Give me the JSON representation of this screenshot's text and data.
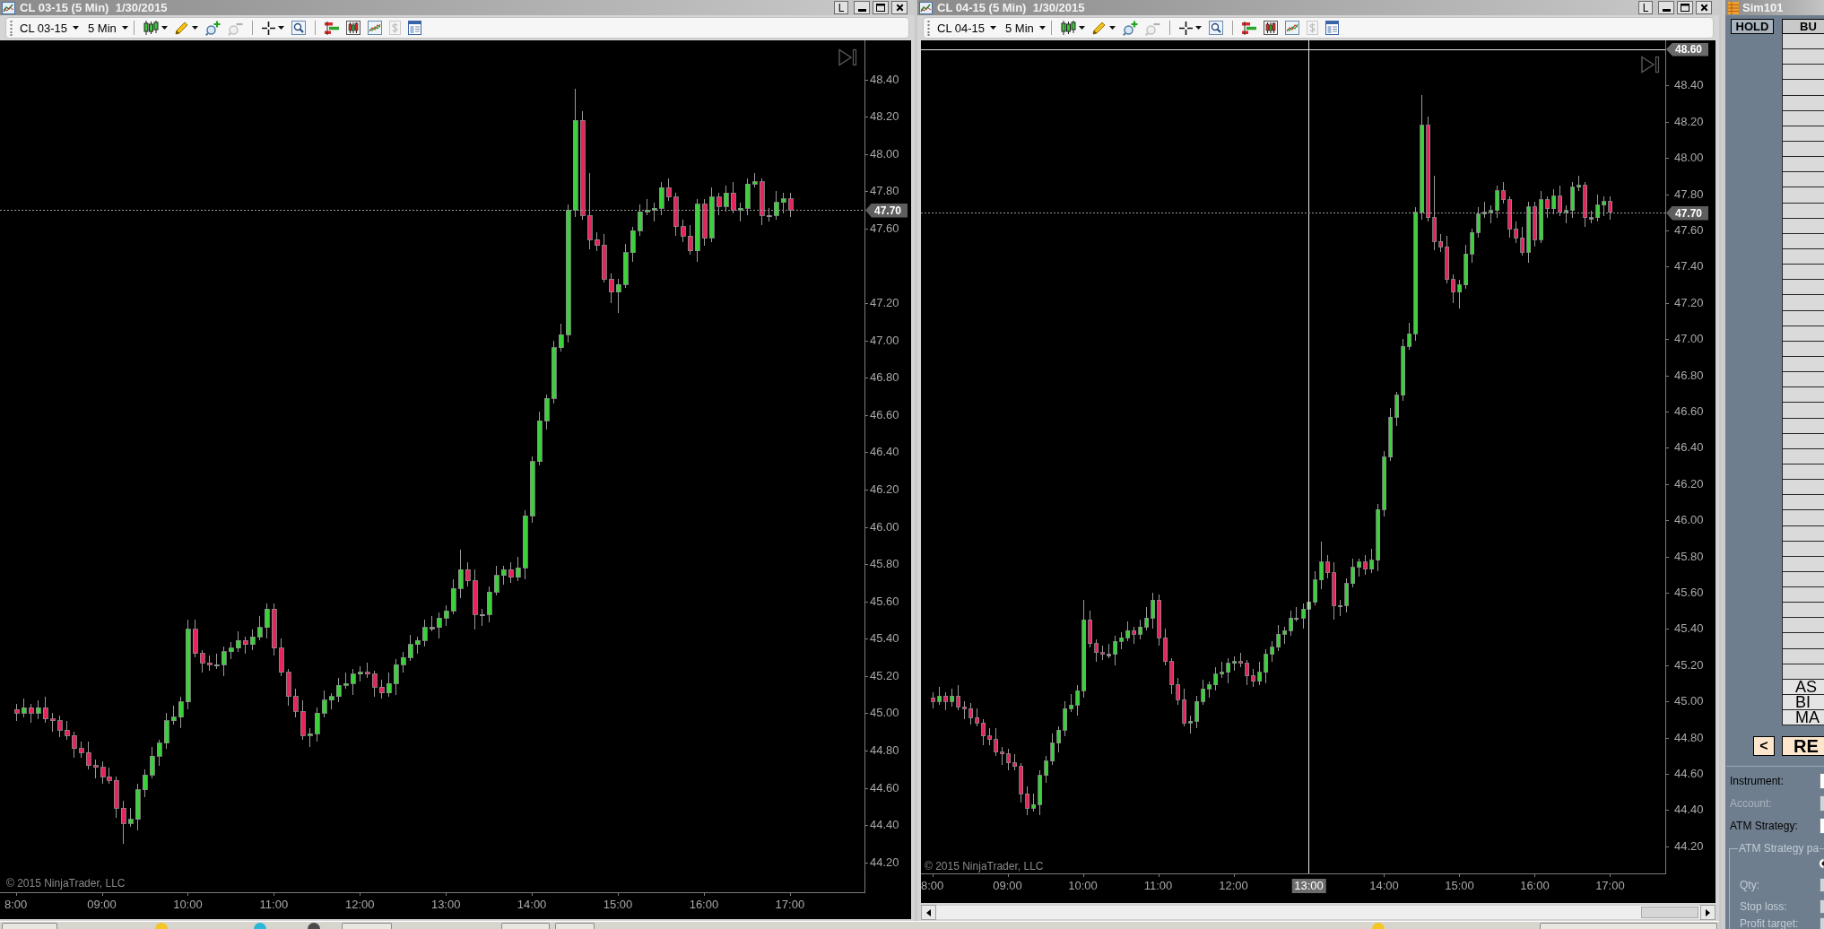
{
  "charts": [
    {
      "title": "CL 03-15 (5 Min)  1/30/2015",
      "title_button": "L",
      "toolbar": {
        "instrument": "CL 03-15",
        "interval": "5 Min",
        "tool_groups": [
          [
            {
              "kind": "chart-style",
              "disabled": false
            },
            {
              "kind": "drawing",
              "disabled": false
            },
            {
              "kind": "zoom-in",
              "disabled": false
            },
            {
              "kind": "zoom-out",
              "disabled": true
            }
          ],
          [
            {
              "kind": "crosshair",
              "disabled": false
            },
            {
              "kind": "find",
              "disabled": false
            }
          ],
          [
            {
              "kind": "order-bars",
              "disabled": false
            },
            {
              "kind": "candles",
              "disabled": false
            },
            {
              "kind": "indicators",
              "disabled": false
            },
            {
              "kind": "dollar",
              "disabled": true
            },
            {
              "kind": "properties",
              "disabled": false
            }
          ]
        ]
      },
      "chart_data": {
        "type": "candlestick",
        "xlim": [
          7.8167,
          17.8667
        ],
        "ylim": [
          44.04,
          48.61
        ],
        "x": [
          8,
          8.0833,
          8.1667,
          8.25,
          8.3333,
          8.4167,
          8.5,
          8.5833,
          8.6667,
          8.75,
          8.8333,
          8.9167,
          9,
          9.0833,
          9.1667,
          9.25,
          9.3333,
          9.4167,
          9.5,
          9.5833,
          9.6667,
          9.75,
          9.8333,
          9.9167,
          10,
          10.0833,
          10.1667,
          10.25,
          10.3333,
          10.4167,
          10.5,
          10.5833,
          10.6667,
          10.75,
          10.8333,
          10.9167,
          11,
          11.0833,
          11.1667,
          11.25,
          11.3333,
          11.4167,
          11.5,
          11.5833,
          11.6667,
          11.75,
          11.8333,
          11.9167,
          12,
          12.0833,
          12.1667,
          12.25,
          12.3333,
          12.4167,
          12.5,
          12.5833,
          12.6667,
          12.75,
          12.8333,
          12.9167,
          13,
          13.0833,
          13.1667,
          13.25,
          13.3333,
          13.4167,
          13.5,
          13.5833,
          13.6667,
          13.75,
          13.8333,
          13.9167,
          14,
          14.0833,
          14.1667,
          14.25,
          14.3333,
          14.4167,
          14.5,
          14.5833,
          14.6667,
          14.75,
          14.8333,
          14.9167,
          15,
          15.0833,
          15.1667,
          15.25,
          15.3333,
          15.4167,
          15.5,
          15.5833,
          15.6667,
          15.75,
          15.8333,
          15.9167,
          16,
          16.0833,
          16.1667,
          16.25,
          16.3333,
          16.4167,
          16.5,
          16.5833,
          16.6667,
          16.75,
          16.8333,
          16.9167,
          17
        ],
        "ohlc": [
          [
            45.02,
            45.05,
            44.96,
            45.0
          ],
          [
            45.0,
            45.08,
            44.98,
            45.03
          ],
          [
            45.03,
            45.05,
            44.95,
            45.0
          ],
          [
            45.0,
            45.07,
            44.97,
            45.03
          ],
          [
            45.03,
            45.09,
            44.95,
            44.97
          ],
          [
            44.97,
            45.0,
            44.9,
            44.96
          ],
          [
            44.96,
            44.99,
            44.87,
            44.91
          ],
          [
            44.91,
            44.96,
            44.86,
            44.88
          ],
          [
            44.88,
            44.9,
            44.76,
            44.81
          ],
          [
            44.81,
            44.85,
            44.76,
            44.79
          ],
          [
            44.79,
            44.85,
            44.7,
            44.72
          ],
          [
            44.72,
            44.75,
            44.65,
            44.71
          ],
          [
            44.71,
            44.74,
            44.62,
            44.66
          ],
          [
            44.66,
            44.71,
            44.62,
            44.64
          ],
          [
            44.64,
            44.66,
            44.44,
            44.49
          ],
          [
            44.49,
            44.53,
            44.3,
            44.41
          ],
          [
            44.41,
            44.49,
            44.39,
            44.43
          ],
          [
            44.43,
            44.62,
            44.37,
            44.59
          ],
          [
            44.59,
            44.7,
            44.55,
            44.67
          ],
          [
            44.67,
            44.82,
            44.65,
            44.77
          ],
          [
            44.77,
            44.86,
            44.72,
            44.84
          ],
          [
            44.84,
            45.0,
            44.81,
            44.96
          ],
          [
            44.96,
            45.04,
            44.94,
            44.98
          ],
          [
            44.98,
            45.09,
            44.92,
            45.06
          ],
          [
            45.06,
            45.5,
            45.02,
            45.45
          ],
          [
            45.45,
            45.5,
            45.3,
            45.32
          ],
          [
            45.32,
            45.34,
            45.22,
            45.27
          ],
          [
            45.27,
            45.31,
            45.23,
            45.26
          ],
          [
            45.26,
            45.32,
            45.24,
            45.26
          ],
          [
            45.26,
            45.36,
            45.2,
            45.33
          ],
          [
            45.33,
            45.38,
            45.29,
            45.35
          ],
          [
            45.35,
            45.44,
            45.33,
            45.39
          ],
          [
            45.39,
            45.41,
            45.32,
            45.37
          ],
          [
            45.37,
            45.45,
            45.34,
            45.41
          ],
          [
            45.41,
            45.52,
            45.39,
            45.46
          ],
          [
            45.46,
            45.59,
            45.4,
            45.56
          ],
          [
            45.56,
            45.59,
            45.31,
            45.35
          ],
          [
            45.35,
            45.4,
            45.2,
            45.22
          ],
          [
            45.22,
            45.24,
            45.04,
            45.09
          ],
          [
            45.09,
            45.13,
            44.98,
            45.01
          ],
          [
            45.01,
            45.07,
            44.86,
            44.88
          ],
          [
            44.88,
            44.92,
            44.82,
            44.89
          ],
          [
            44.89,
            45.03,
            44.85,
            45.0
          ],
          [
            45.0,
            45.12,
            44.98,
            45.07
          ],
          [
            45.07,
            45.11,
            45.02,
            45.09
          ],
          [
            45.09,
            45.19,
            45.06,
            45.15
          ],
          [
            45.15,
            45.22,
            45.13,
            45.16
          ],
          [
            45.16,
            45.24,
            45.1,
            45.21
          ],
          [
            45.21,
            45.25,
            45.17,
            45.22
          ],
          [
            45.22,
            45.27,
            45.19,
            45.21
          ],
          [
            45.21,
            45.23,
            45.09,
            45.14
          ],
          [
            45.14,
            45.18,
            45.08,
            45.11
          ],
          [
            45.11,
            45.22,
            45.09,
            45.16
          ],
          [
            45.16,
            45.29,
            45.1,
            45.26
          ],
          [
            45.26,
            45.33,
            45.22,
            45.3
          ],
          [
            45.3,
            45.42,
            45.28,
            45.37
          ],
          [
            45.37,
            45.41,
            45.32,
            45.39
          ],
          [
            45.39,
            45.5,
            45.36,
            45.46
          ],
          [
            45.46,
            45.52,
            45.44,
            45.46
          ],
          [
            45.46,
            45.54,
            45.4,
            45.51
          ],
          [
            45.51,
            45.58,
            45.47,
            45.55
          ],
          [
            45.55,
            45.72,
            45.53,
            45.67
          ],
          [
            45.67,
            45.88,
            45.62,
            45.77
          ],
          [
            45.77,
            45.81,
            45.68,
            45.71
          ],
          [
            45.71,
            45.77,
            45.45,
            45.53
          ],
          [
            45.53,
            45.56,
            45.47,
            45.53
          ],
          [
            45.53,
            45.68,
            45.49,
            45.65
          ],
          [
            45.65,
            45.79,
            45.63,
            45.74
          ],
          [
            45.74,
            45.79,
            45.69,
            45.77
          ],
          [
            45.77,
            45.81,
            45.7,
            45.73
          ],
          [
            45.73,
            45.84,
            45.71,
            45.78
          ],
          [
            45.78,
            46.09,
            45.72,
            46.06
          ],
          [
            46.06,
            46.38,
            46.02,
            46.35
          ],
          [
            46.35,
            46.62,
            46.33,
            46.57
          ],
          [
            46.57,
            46.71,
            46.52,
            46.69
          ],
          [
            46.69,
            47.0,
            46.66,
            46.96
          ],
          [
            46.96,
            47.09,
            46.94,
            47.03
          ],
          [
            47.03,
            47.73,
            46.99,
            47.7
          ],
          [
            47.7,
            48.35,
            47.66,
            48.18
          ],
          [
            48.18,
            48.23,
            47.65,
            47.67
          ],
          [
            47.67,
            47.9,
            47.49,
            47.54
          ],
          [
            47.54,
            47.58,
            47.48,
            47.51
          ],
          [
            47.51,
            47.57,
            47.31,
            47.33
          ],
          [
            47.33,
            47.36,
            47.2,
            47.26
          ],
          [
            47.26,
            47.33,
            47.15,
            47.3
          ],
          [
            47.3,
            47.52,
            47.28,
            47.47
          ],
          [
            47.47,
            47.61,
            47.42,
            47.59
          ],
          [
            47.59,
            47.73,
            47.56,
            47.69
          ],
          [
            47.69,
            47.76,
            47.67,
            47.7
          ],
          [
            47.7,
            47.74,
            47.64,
            47.71
          ],
          [
            47.71,
            47.85,
            47.67,
            47.82
          ],
          [
            47.82,
            47.87,
            47.75,
            47.77
          ],
          [
            47.77,
            47.79,
            47.56,
            47.61
          ],
          [
            47.61,
            47.65,
            47.53,
            47.56
          ],
          [
            47.56,
            47.62,
            47.46,
            47.48
          ],
          [
            47.48,
            47.76,
            47.42,
            47.73
          ],
          [
            47.73,
            47.76,
            47.51,
            47.55
          ],
          [
            47.55,
            47.82,
            47.53,
            47.77
          ],
          [
            47.77,
            47.79,
            47.67,
            47.72
          ],
          [
            47.72,
            47.83,
            47.69,
            47.79
          ],
          [
            47.79,
            47.85,
            47.68,
            47.7
          ],
          [
            47.7,
            47.74,
            47.64,
            47.71
          ],
          [
            47.71,
            47.87,
            47.67,
            47.84
          ],
          [
            47.84,
            47.9,
            47.82,
            47.85
          ],
          [
            47.85,
            47.87,
            47.62,
            47.67
          ],
          [
            47.67,
            47.71,
            47.64,
            47.67
          ],
          [
            47.67,
            47.8,
            47.65,
            47.74
          ],
          [
            47.74,
            47.79,
            47.68,
            47.76
          ],
          [
            47.76,
            47.79,
            47.66,
            47.7
          ]
        ],
        "yticks": [
          {
            "value": 48.4,
            "label": "48.40"
          },
          {
            "value": 48.2,
            "label": "48.20"
          },
          {
            "value": 48.0,
            "label": "48.00"
          },
          {
            "value": 47.8,
            "label": "47.80"
          },
          {
            "value": 47.6,
            "label": "47.60"
          },
          {
            "value": 47.2,
            "label": "47.20"
          },
          {
            "value": 47.0,
            "label": "47.00"
          },
          {
            "value": 46.8,
            "label": "46.80"
          },
          {
            "value": 46.6,
            "label": "46.60"
          },
          {
            "value": 46.4,
            "label": "46.40"
          },
          {
            "value": 46.2,
            "label": "46.20"
          },
          {
            "value": 46.0,
            "label": "46.00"
          },
          {
            "value": 45.8,
            "label": "45.80"
          },
          {
            "value": 45.6,
            "label": "45.60"
          },
          {
            "value": 45.4,
            "label": "45.40"
          },
          {
            "value": 45.2,
            "label": "45.20"
          },
          {
            "value": 45.0,
            "label": "45.00"
          },
          {
            "value": 44.8,
            "label": "44.80"
          },
          {
            "value": 44.6,
            "label": "44.60"
          },
          {
            "value": 44.4,
            "label": "44.40"
          },
          {
            "value": 44.2,
            "label": "44.20"
          }
        ],
        "xticks": [
          {
            "value": 8,
            "label": "8:00"
          },
          {
            "value": 9,
            "label": "09:00"
          },
          {
            "value": 10,
            "label": "10:00"
          },
          {
            "value": 11,
            "label": "11:00"
          },
          {
            "value": 12,
            "label": "12:00"
          },
          {
            "value": 13,
            "label": "13:00"
          },
          {
            "value": 14,
            "label": "14:00"
          },
          {
            "value": 15,
            "label": "15:00"
          },
          {
            "value": 16,
            "label": "16:00"
          },
          {
            "value": 17,
            "label": "17:00"
          }
        ],
        "ref_lines": [
          {
            "axis": "y",
            "value": 47.7,
            "label": "47.70",
            "color": "#9a9a9a"
          }
        ]
      },
      "copyright": "© 2015 NinjaTrader, LLC"
    },
    {
      "title": "CL 04-15 (5 Min)  1/30/2015",
      "title_button": "L",
      "toolbar": {
        "instrument": "CL 04-15",
        "interval": "5 Min",
        "tool_groups": [
          [
            {
              "kind": "chart-style",
              "disabled": false
            },
            {
              "kind": "drawing",
              "disabled": false
            },
            {
              "kind": "zoom-in",
              "disabled": false
            },
            {
              "kind": "zoom-out",
              "disabled": true
            }
          ],
          [
            {
              "kind": "crosshair",
              "disabled": false
            },
            {
              "kind": "find",
              "disabled": false
            }
          ],
          [
            {
              "kind": "order-bars",
              "disabled": false
            },
            {
              "kind": "candles",
              "disabled": false
            },
            {
              "kind": "indicators",
              "disabled": false
            },
            {
              "kind": "dollar",
              "disabled": true
            },
            {
              "kind": "properties",
              "disabled": false
            }
          ]
        ]
      },
      "chart_data": {
        "type": "candlestick",
        "xlim": [
          7.85,
          17.7333
        ],
        "ylim": [
          44.05,
          48.65
        ],
        "x": [
          8,
          8.0833,
          8.1667,
          8.25,
          8.3333,
          8.4167,
          8.5,
          8.5833,
          8.6667,
          8.75,
          8.8333,
          8.9167,
          9,
          9.0833,
          9.1667,
          9.25,
          9.3333,
          9.4167,
          9.5,
          9.5833,
          9.6667,
          9.75,
          9.8333,
          9.9167,
          10,
          10.0833,
          10.1667,
          10.25,
          10.3333,
          10.4167,
          10.5,
          10.5833,
          10.6667,
          10.75,
          10.8333,
          10.9167,
          11,
          11.0833,
          11.1667,
          11.25,
          11.3333,
          11.4167,
          11.5,
          11.5833,
          11.6667,
          11.75,
          11.8333,
          11.9167,
          12,
          12.0833,
          12.1667,
          12.25,
          12.3333,
          12.4167,
          12.5,
          12.5833,
          12.6667,
          12.75,
          12.8333,
          12.9167,
          13,
          13.0833,
          13.1667,
          13.25,
          13.3333,
          13.4167,
          13.5,
          13.5833,
          13.6667,
          13.75,
          13.8333,
          13.9167,
          14,
          14.0833,
          14.1667,
          14.25,
          14.3333,
          14.4167,
          14.5,
          14.5833,
          14.6667,
          14.75,
          14.8333,
          14.9167,
          15,
          15.0833,
          15.1667,
          15.25,
          15.3333,
          15.4167,
          15.5,
          15.5833,
          15.6667,
          15.75,
          15.8333,
          15.9167,
          16,
          16.0833,
          16.1667,
          16.25,
          16.3333,
          16.4167,
          16.5,
          16.5833,
          16.6667,
          16.75,
          16.8333,
          16.9167,
          17
        ],
        "ohlc": [
          [
            45.02,
            45.05,
            44.96,
            45.0
          ],
          [
            45.0,
            45.08,
            44.98,
            45.03
          ],
          [
            45.03,
            45.05,
            44.95,
            45.0
          ],
          [
            45.0,
            45.07,
            44.97,
            45.03
          ],
          [
            45.03,
            45.09,
            44.95,
            44.97
          ],
          [
            44.97,
            45.0,
            44.9,
            44.96
          ],
          [
            44.96,
            44.99,
            44.87,
            44.91
          ],
          [
            44.91,
            44.96,
            44.86,
            44.88
          ],
          [
            44.88,
            44.9,
            44.76,
            44.81
          ],
          [
            44.81,
            44.85,
            44.76,
            44.79
          ],
          [
            44.79,
            44.85,
            44.7,
            44.72
          ],
          [
            44.72,
            44.75,
            44.65,
            44.71
          ],
          [
            44.71,
            44.74,
            44.62,
            44.66
          ],
          [
            44.66,
            44.71,
            44.62,
            44.64
          ],
          [
            44.64,
            44.66,
            44.44,
            44.49
          ],
          [
            44.49,
            44.53,
            44.37,
            44.41
          ],
          [
            44.41,
            44.49,
            44.39,
            44.43
          ],
          [
            44.43,
            44.62,
            44.37,
            44.59
          ],
          [
            44.59,
            44.7,
            44.55,
            44.67
          ],
          [
            44.67,
            44.82,
            44.65,
            44.77
          ],
          [
            44.77,
            44.86,
            44.72,
            44.84
          ],
          [
            44.84,
            45.0,
            44.81,
            44.96
          ],
          [
            44.96,
            45.04,
            44.94,
            44.98
          ],
          [
            44.98,
            45.09,
            44.92,
            45.06
          ],
          [
            45.06,
            45.56,
            45.02,
            45.45
          ],
          [
            45.45,
            45.5,
            45.3,
            45.32
          ],
          [
            45.32,
            45.34,
            45.22,
            45.27
          ],
          [
            45.27,
            45.31,
            45.23,
            45.26
          ],
          [
            45.26,
            45.32,
            45.24,
            45.26
          ],
          [
            45.26,
            45.36,
            45.2,
            45.33
          ],
          [
            45.33,
            45.38,
            45.29,
            45.35
          ],
          [
            45.35,
            45.44,
            45.33,
            45.39
          ],
          [
            45.39,
            45.41,
            45.32,
            45.37
          ],
          [
            45.37,
            45.45,
            45.34,
            45.41
          ],
          [
            45.41,
            45.52,
            45.39,
            45.46
          ],
          [
            45.46,
            45.6,
            45.4,
            45.56
          ],
          [
            45.56,
            45.59,
            45.31,
            45.35
          ],
          [
            45.35,
            45.4,
            45.2,
            45.22
          ],
          [
            45.22,
            45.24,
            45.04,
            45.09
          ],
          [
            45.09,
            45.13,
            44.98,
            45.01
          ],
          [
            45.01,
            45.07,
            44.86,
            44.88
          ],
          [
            44.88,
            44.92,
            44.82,
            44.89
          ],
          [
            44.89,
            45.03,
            44.85,
            45.0
          ],
          [
            45.0,
            45.12,
            44.98,
            45.07
          ],
          [
            45.07,
            45.11,
            45.02,
            45.09
          ],
          [
            45.09,
            45.19,
            45.06,
            45.15
          ],
          [
            45.15,
            45.22,
            45.13,
            45.16
          ],
          [
            45.16,
            45.24,
            45.1,
            45.21
          ],
          [
            45.21,
            45.25,
            45.17,
            45.22
          ],
          [
            45.22,
            45.27,
            45.19,
            45.21
          ],
          [
            45.21,
            45.23,
            45.09,
            45.14
          ],
          [
            45.14,
            45.18,
            45.08,
            45.11
          ],
          [
            45.11,
            45.22,
            45.09,
            45.16
          ],
          [
            45.16,
            45.29,
            45.1,
            45.26
          ],
          [
            45.26,
            45.33,
            45.22,
            45.3
          ],
          [
            45.3,
            45.42,
            45.28,
            45.37
          ],
          [
            45.37,
            45.41,
            45.32,
            45.39
          ],
          [
            45.39,
            45.5,
            45.36,
            45.46
          ],
          [
            45.46,
            45.52,
            45.44,
            45.46
          ],
          [
            45.46,
            45.54,
            45.4,
            45.51
          ],
          [
            45.51,
            45.58,
            45.47,
            45.55
          ],
          [
            45.55,
            45.72,
            45.53,
            45.67
          ],
          [
            45.67,
            45.88,
            45.62,
            45.77
          ],
          [
            45.77,
            45.81,
            45.68,
            45.71
          ],
          [
            45.71,
            45.77,
            45.45,
            45.53
          ],
          [
            45.53,
            45.56,
            45.47,
            45.53
          ],
          [
            45.53,
            45.68,
            45.49,
            45.65
          ],
          [
            45.65,
            45.79,
            45.63,
            45.74
          ],
          [
            45.74,
            45.79,
            45.69,
            45.77
          ],
          [
            45.77,
            45.81,
            45.7,
            45.73
          ],
          [
            45.73,
            45.84,
            45.71,
            45.78
          ],
          [
            45.78,
            46.09,
            45.72,
            46.06
          ],
          [
            46.06,
            46.38,
            46.02,
            46.35
          ],
          [
            46.35,
            46.62,
            46.33,
            46.57
          ],
          [
            46.57,
            46.71,
            46.52,
            46.69
          ],
          [
            46.69,
            47.0,
            46.66,
            46.96
          ],
          [
            46.96,
            47.09,
            46.94,
            47.03
          ],
          [
            47.03,
            47.73,
            46.99,
            47.7
          ],
          [
            47.7,
            48.35,
            47.66,
            48.18
          ],
          [
            48.18,
            48.23,
            47.65,
            47.67
          ],
          [
            47.67,
            47.9,
            47.49,
            47.54
          ],
          [
            47.54,
            47.58,
            47.48,
            47.51
          ],
          [
            47.51,
            47.57,
            47.31,
            47.33
          ],
          [
            47.33,
            47.36,
            47.2,
            47.26
          ],
          [
            47.26,
            47.33,
            47.17,
            47.3
          ],
          [
            47.3,
            47.52,
            47.28,
            47.47
          ],
          [
            47.47,
            47.61,
            47.42,
            47.59
          ],
          [
            47.59,
            47.73,
            47.56,
            47.69
          ],
          [
            47.69,
            47.76,
            47.67,
            47.7
          ],
          [
            47.7,
            47.74,
            47.64,
            47.71
          ],
          [
            47.71,
            47.85,
            47.67,
            47.82
          ],
          [
            47.82,
            47.87,
            47.75,
            47.77
          ],
          [
            47.77,
            47.79,
            47.56,
            47.61
          ],
          [
            47.61,
            47.65,
            47.53,
            47.56
          ],
          [
            47.56,
            47.62,
            47.46,
            47.48
          ],
          [
            47.48,
            47.76,
            47.42,
            47.73
          ],
          [
            47.73,
            47.76,
            47.51,
            47.55
          ],
          [
            47.55,
            47.82,
            47.53,
            47.77
          ],
          [
            47.77,
            47.79,
            47.67,
            47.72
          ],
          [
            47.72,
            47.83,
            47.69,
            47.79
          ],
          [
            47.79,
            47.85,
            47.68,
            47.7
          ],
          [
            47.7,
            47.74,
            47.64,
            47.71
          ],
          [
            47.71,
            47.87,
            47.67,
            47.84
          ],
          [
            47.84,
            47.9,
            47.82,
            47.85
          ],
          [
            47.85,
            47.87,
            47.62,
            47.67
          ],
          [
            47.67,
            47.71,
            47.64,
            47.67
          ],
          [
            47.67,
            47.8,
            47.65,
            47.74
          ],
          [
            47.74,
            47.79,
            47.68,
            47.76
          ],
          [
            47.76,
            47.79,
            47.66,
            47.7
          ]
        ],
        "yticks": [
          {
            "value": 48.4,
            "label": "48.40"
          },
          {
            "value": 48.2,
            "label": "48.20"
          },
          {
            "value": 48.0,
            "label": "48.00"
          },
          {
            "value": 47.8,
            "label": "47.80"
          },
          {
            "value": 47.6,
            "label": "47.60"
          },
          {
            "value": 47.4,
            "label": "47.40"
          },
          {
            "value": 47.2,
            "label": "47.20"
          },
          {
            "value": 47.0,
            "label": "47.00"
          },
          {
            "value": 46.8,
            "label": "46.80"
          },
          {
            "value": 46.6,
            "label": "46.60"
          },
          {
            "value": 46.4,
            "label": "46.40"
          },
          {
            "value": 46.2,
            "label": "46.20"
          },
          {
            "value": 46.0,
            "label": "46.00"
          },
          {
            "value": 45.8,
            "label": "45.80"
          },
          {
            "value": 45.6,
            "label": "45.60"
          },
          {
            "value": 45.4,
            "label": "45.40"
          },
          {
            "value": 45.2,
            "label": "45.20"
          },
          {
            "value": 45.0,
            "label": "45.00"
          },
          {
            "value": 44.8,
            "label": "44.80"
          },
          {
            "value": 44.6,
            "label": "44.60"
          },
          {
            "value": 44.4,
            "label": "44.40"
          },
          {
            "value": 44.2,
            "label": "44.20"
          }
        ],
        "xticks": [
          {
            "value": 8,
            "label": "8:00"
          },
          {
            "value": 9,
            "label": "09:00"
          },
          {
            "value": 10,
            "label": "10:00"
          },
          {
            "value": 11,
            "label": "11:00"
          },
          {
            "value": 12,
            "label": "12:00"
          },
          {
            "value": 14,
            "label": "14:00"
          },
          {
            "value": 15,
            "label": "15:00"
          },
          {
            "value": 16,
            "label": "16:00"
          },
          {
            "value": 17,
            "label": "17:00"
          }
        ],
        "ref_lines": [
          {
            "axis": "x",
            "value": 13,
            "label": "13:00",
            "color": "#e6e6e6"
          },
          {
            "axis": "y",
            "value": 48.6,
            "label": "48.60",
            "color": "#e6e6e6"
          },
          {
            "axis": "y",
            "value": 47.7,
            "label": "47.70",
            "color": "#9a9a9a"
          }
        ]
      },
      "copyright": "© 2015 NinjaTrader, LLC"
    }
  ],
  "order_panel": {
    "title": "Sim101",
    "hold_button": "HOLD",
    "buy_header": "BU",
    "quote_rows": [
      "AS",
      "BI",
      "MA"
    ],
    "back_button": "<",
    "reverse_button": "RE",
    "fields": [
      {
        "label": "Instrument:",
        "disabled": false
      },
      {
        "label": "Account:",
        "disabled": true
      },
      {
        "label": "ATM Strategy:",
        "disabled": false
      }
    ],
    "group_label": "ATM Strategy pa",
    "radio_checked": true,
    "group_fields": [
      {
        "label": "Qty:",
        "disabled": true
      },
      {
        "label": "Stop loss:",
        "disabled": true
      },
      {
        "label": "Profit target:",
        "disabled": true
      }
    ]
  }
}
